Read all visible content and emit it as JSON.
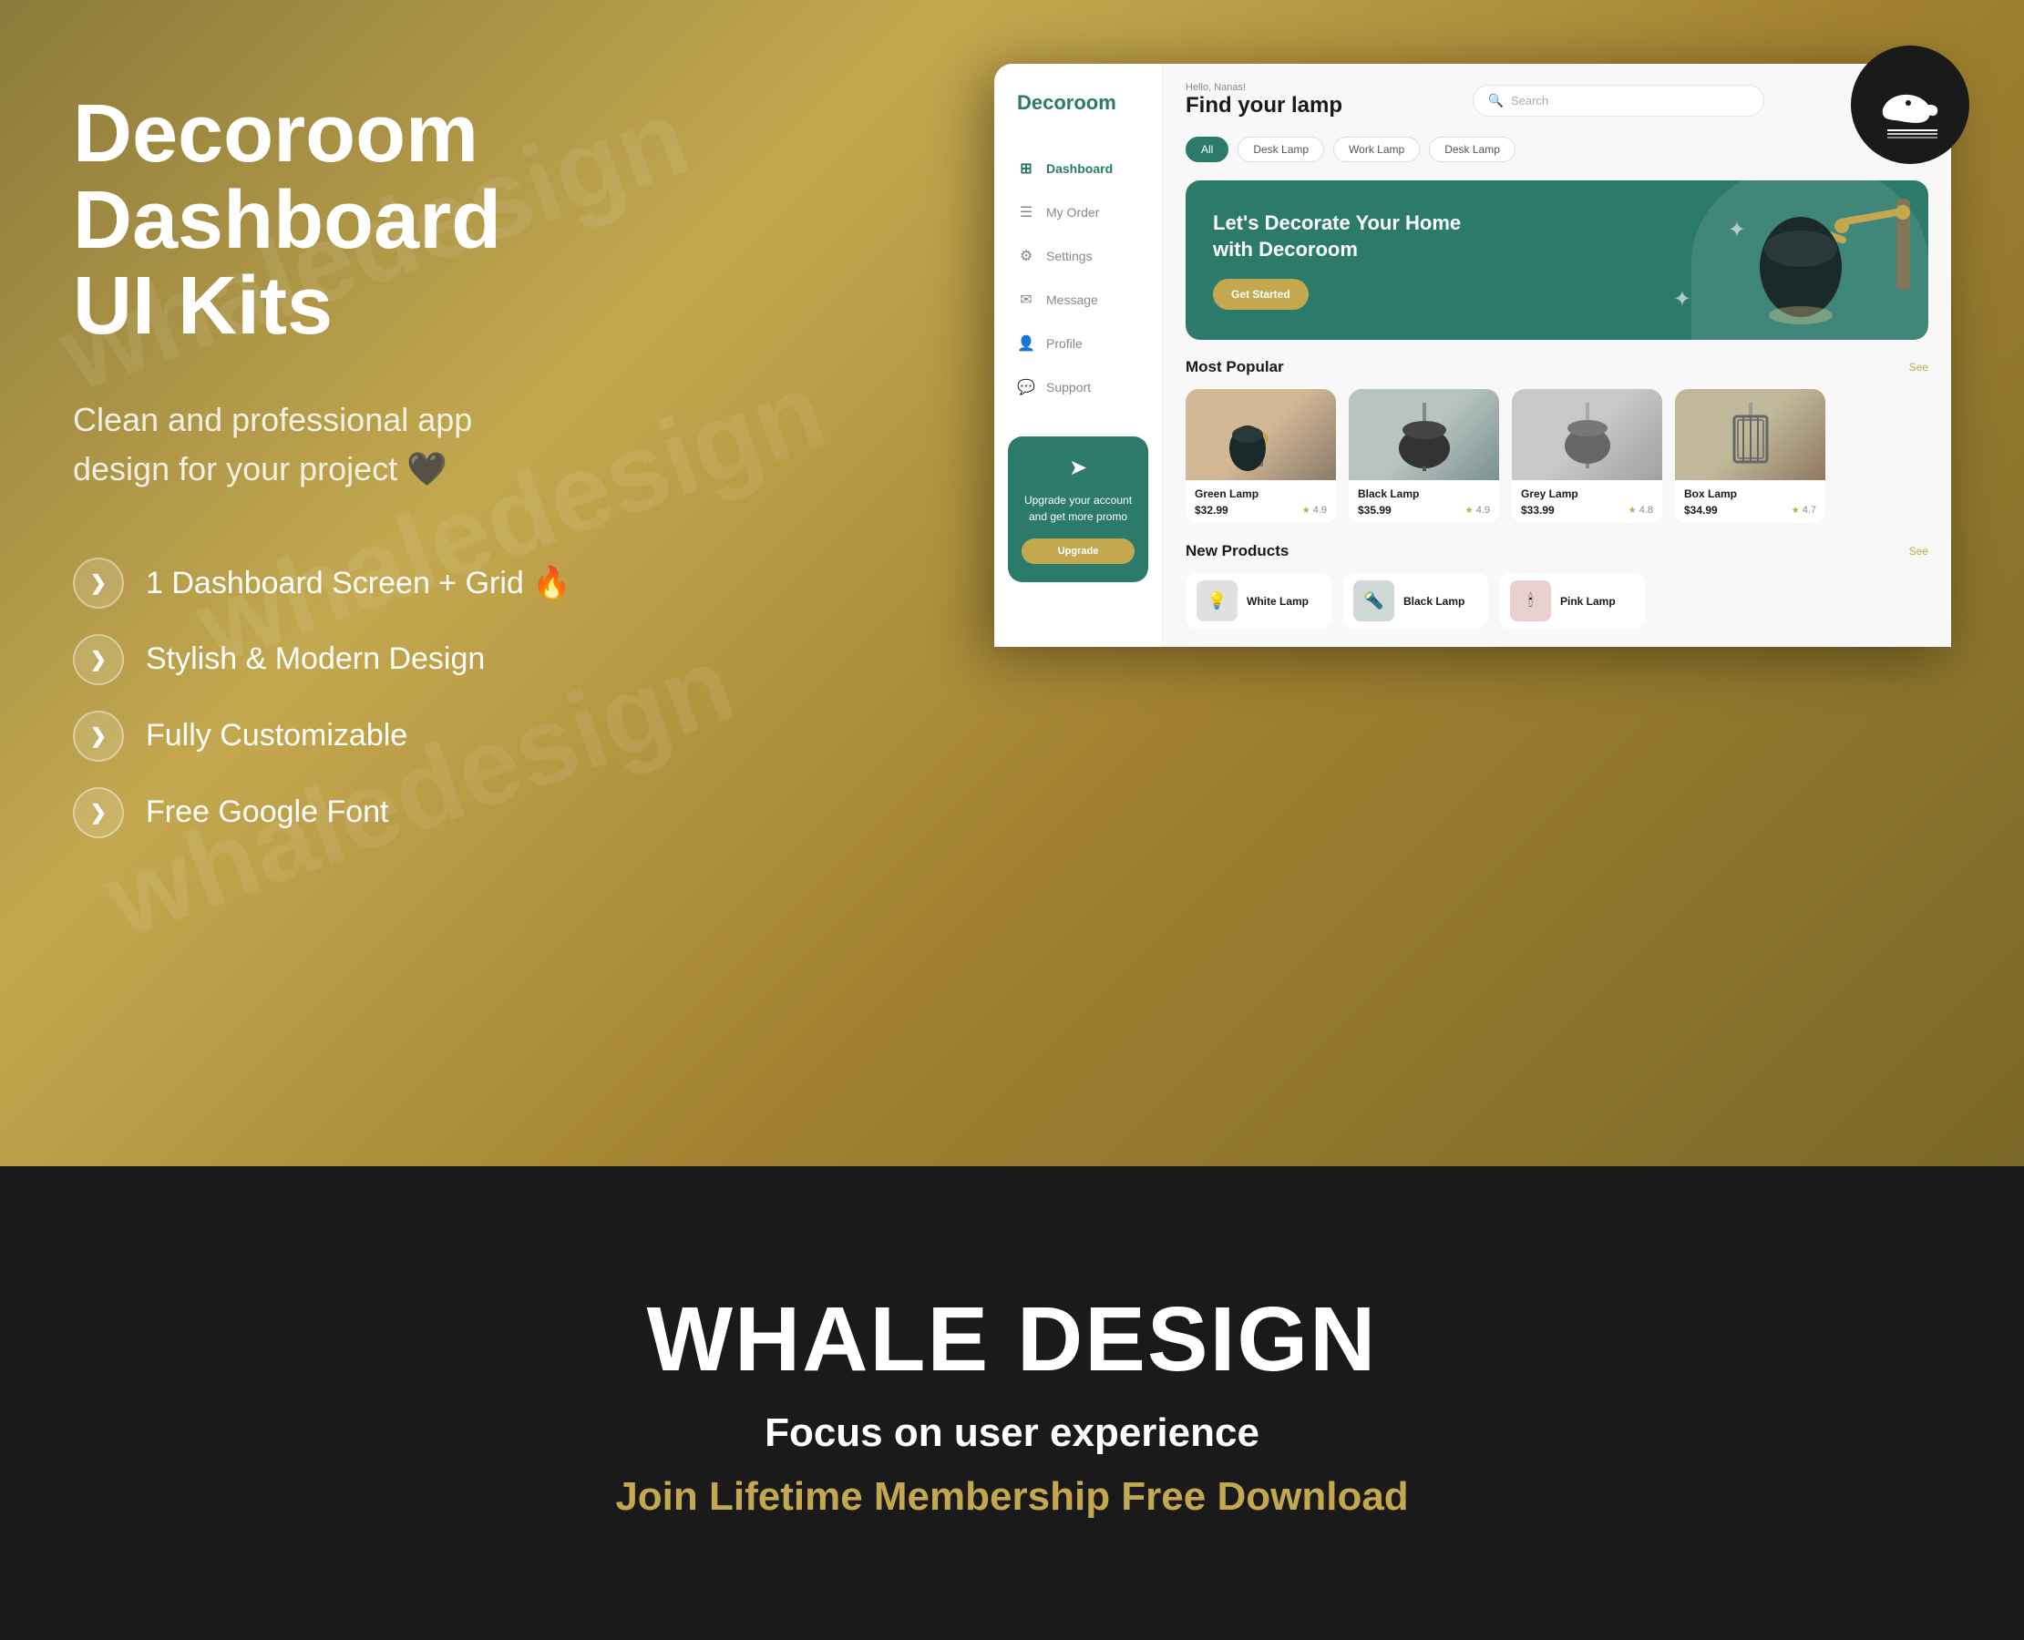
{
  "brand": {
    "name": "Decoroom",
    "logo_text": "Decoroom"
  },
  "left": {
    "title_line1": "Decoroom",
    "title_line2": "Dashboard",
    "title_line3": "UI Kits",
    "subtitle": "Clean and professional app design for your project 🖤",
    "features": [
      {
        "id": "f1",
        "text": "1 Dashboard Screen + Grid 🔥"
      },
      {
        "id": "f2",
        "text": "Stylish & Modern Design"
      },
      {
        "id": "f3",
        "text": "Fully Customizable"
      },
      {
        "id": "f4",
        "text": "Free Google Font"
      }
    ],
    "feature_icon": "❯"
  },
  "dashboard": {
    "greeting": "Hello, Nanas!",
    "find_title": "Find your lamp",
    "search_placeholder": "Search",
    "filter_tabs": [
      {
        "id": "all",
        "label": "All",
        "active": true
      },
      {
        "id": "desk1",
        "label": "Desk Lamp",
        "active": false
      },
      {
        "id": "work",
        "label": "Work Lamp",
        "active": false
      },
      {
        "id": "desk2",
        "label": "Desk Lamp",
        "active": false
      }
    ],
    "hero": {
      "title": "Let's Decorate Your Home with Decoroom",
      "button": "Get Started"
    },
    "most_popular": {
      "section_title": "Most Popular",
      "see_all": "See",
      "products": [
        {
          "id": "p1",
          "name": "Green Lamp",
          "price": "$32.99",
          "rating": "4.9",
          "bg": "lamp-green"
        },
        {
          "id": "p2",
          "name": "Black Lamp",
          "price": "$35.99",
          "rating": "4.9",
          "bg": "lamp-black"
        },
        {
          "id": "p3",
          "name": "Grey Lamp",
          "price": "$33.99",
          "rating": "4.8",
          "bg": "lamp-grey"
        },
        {
          "id": "p4",
          "name": "Box Lamp",
          "price": "$34.99",
          "rating": "4.7",
          "bg": "lamp-box"
        }
      ]
    },
    "new_products": {
      "section_title": "New Products",
      "see_all": "See",
      "items": [
        {
          "id": "n1",
          "name": "White Lamp"
        },
        {
          "id": "n2",
          "name": "Black Lamp"
        },
        {
          "id": "n3",
          "name": "Pink Lamp"
        },
        {
          "id": "n4",
          "name": "..."
        }
      ]
    },
    "sidebar": {
      "logo": "Decoroom",
      "nav_items": [
        {
          "id": "dashboard",
          "label": "Dashboard",
          "icon": "⊞",
          "active": true
        },
        {
          "id": "my-order",
          "label": "My Order",
          "icon": "☰",
          "active": false
        },
        {
          "id": "settings",
          "label": "Settings",
          "icon": "⚙",
          "active": false
        },
        {
          "id": "message",
          "label": "Message",
          "icon": "✉",
          "active": false
        },
        {
          "id": "profile",
          "label": "Profile",
          "icon": "👤",
          "active": false
        },
        {
          "id": "support",
          "label": "Support",
          "icon": "💬",
          "active": false
        }
      ],
      "upgrade_card": {
        "icon": "➤",
        "text": "Upgrade your account and get more promo",
        "button": "Upgrade"
      }
    }
  },
  "bottom": {
    "brand_title": "WHALE DESIGN",
    "focus_text": "Focus on user experience",
    "join_text": "Join Lifetime Membership Free Download"
  },
  "watermarks": [
    "whaledesign",
    "whaledesign",
    "whaledesign"
  ]
}
